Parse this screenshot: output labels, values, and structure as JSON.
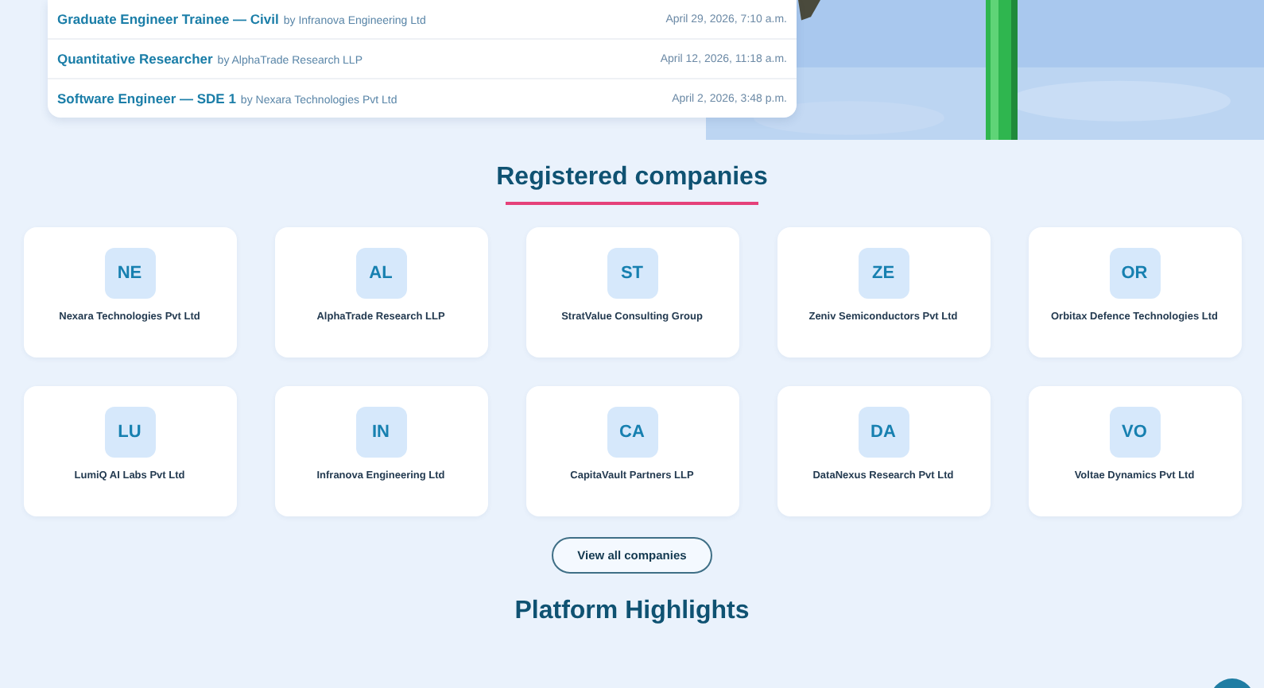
{
  "recent_jobs": [
    {
      "title": "Graduate Engineer Trainee — Civil",
      "byline": "by Infranova Engineering Ltd",
      "date": "April 29, 2026, 7:10 a.m."
    },
    {
      "title": "Quantitative Researcher",
      "byline": "by AlphaTrade Research LLP",
      "date": "April 12, 2026, 11:18 a.m."
    },
    {
      "title": "Software Engineer — SDE 1",
      "byline": "by Nexara Technologies Pvt Ltd",
      "date": "April 2, 2026, 3:48 p.m."
    }
  ],
  "companies_section": {
    "title": "Registered companies",
    "companies": [
      {
        "initials": "NE",
        "name": "Nexara Technologies Pvt Ltd"
      },
      {
        "initials": "AL",
        "name": "AlphaTrade Research LLP"
      },
      {
        "initials": "ST",
        "name": "StratValue Consulting Group"
      },
      {
        "initials": "ZE",
        "name": "Zeniv Semiconductors Pvt Ltd"
      },
      {
        "initials": "OR",
        "name": "Orbitax Defence Technologies Ltd"
      },
      {
        "initials": "LU",
        "name": "LumiQ AI Labs Pvt Ltd"
      },
      {
        "initials": "IN",
        "name": "Infranova Engineering Ltd"
      },
      {
        "initials": "CA",
        "name": "CapitaVault Partners LLP"
      },
      {
        "initials": "DA",
        "name": "DataNexus Research Pvt Ltd"
      },
      {
        "initials": "VO",
        "name": "Voltae Dynamics Pvt Ltd"
      }
    ],
    "button": "View all companies"
  },
  "highlights_section": {
    "title": "Platform Highlights"
  }
}
